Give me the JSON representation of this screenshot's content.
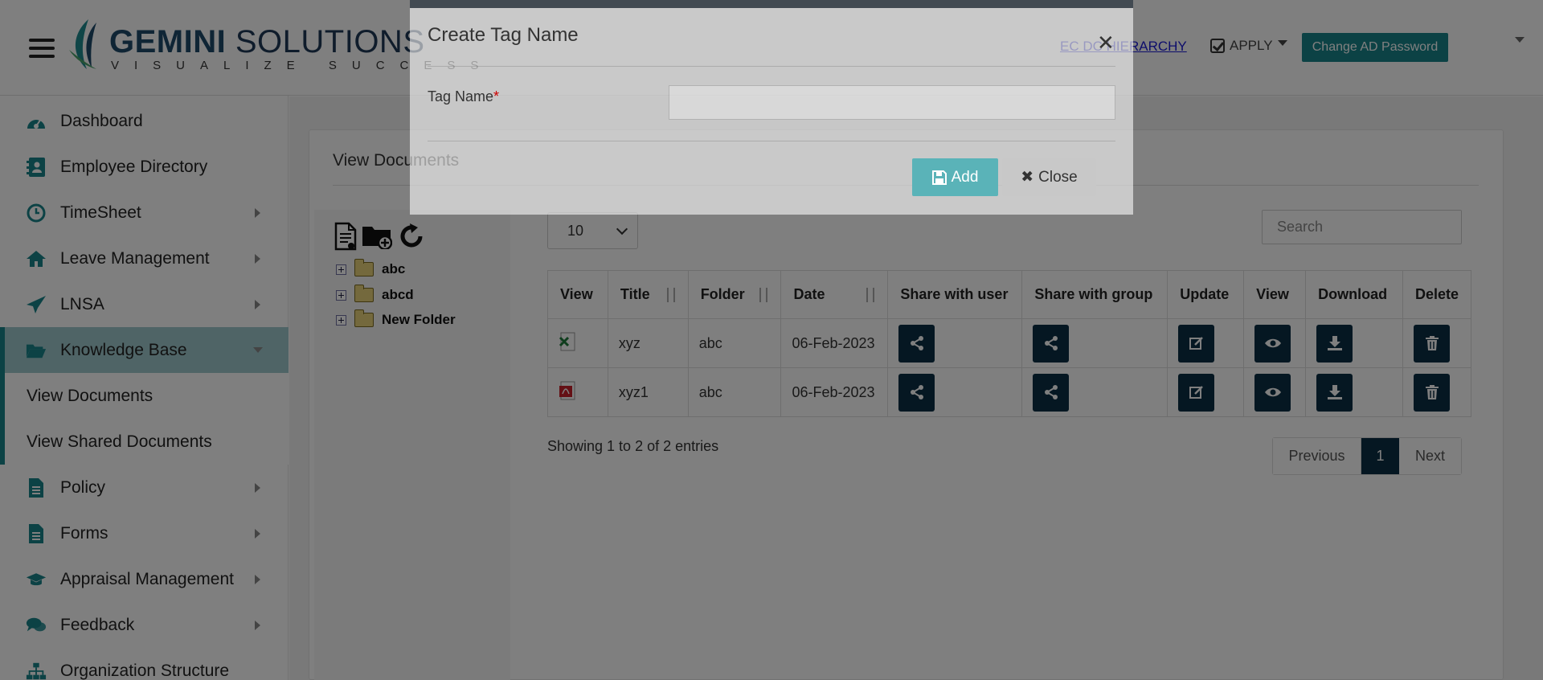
{
  "header": {
    "logo_main_bold": "GEMINI",
    "logo_main_rest": " SOLUTIONS",
    "logo_tagline": "VISUALIZE SUCCESS",
    "hierarchy_link": "EC DC HIERARCHY",
    "apply_label": "APPLY",
    "change_password_label": "Change AD Password"
  },
  "sidebar": {
    "items": [
      {
        "label": "Dashboard",
        "icon": "dashboard-icon"
      },
      {
        "label": "Employee Directory",
        "icon": "address-book-icon"
      },
      {
        "label": "TimeSheet",
        "icon": "clock-icon"
      },
      {
        "label": "Leave Management",
        "icon": "home-icon"
      },
      {
        "label": "LNSA",
        "icon": "paper-plane-icon"
      },
      {
        "label": "Knowledge Base",
        "icon": "folder-open-icon"
      },
      {
        "label": "Policy",
        "icon": "document-icon"
      },
      {
        "label": "Forms",
        "icon": "document-icon"
      },
      {
        "label": "Appraisal Management",
        "icon": "graduation-cap-icon"
      },
      {
        "label": "Feedback",
        "icon": "comments-icon"
      },
      {
        "label": "Organization Structure",
        "icon": "sitemap-icon"
      }
    ],
    "sub_items": [
      "View Documents",
      "View Shared Documents"
    ]
  },
  "main": {
    "title": "View Documents",
    "tree": {
      "folders": [
        "abc",
        "abcd",
        "New Folder"
      ]
    },
    "page_length": "10",
    "search_placeholder": "Search",
    "table": {
      "columns": [
        "View",
        "Title",
        "Folder",
        "Date",
        "Share with user",
        "Share with group",
        "Update",
        "View",
        "Download",
        "Delete"
      ],
      "rows": [
        {
          "file_type": "excel",
          "title": "xyz",
          "folder": "abc",
          "date": "06-Feb-2023"
        },
        {
          "file_type": "pdf",
          "title": "xyz1",
          "folder": "abc",
          "date": "06-Feb-2023"
        }
      ]
    },
    "info": "Showing 1 to 2 of 2 entries",
    "pagination": {
      "previous": "Previous",
      "current": "1",
      "next": "Next"
    }
  },
  "modal": {
    "title": "Create Tag Name",
    "field_label": "Tag Name",
    "required_mark": "*",
    "field_value": "",
    "add_label": "Add",
    "close_label": "Close"
  },
  "colors": {
    "accent": "#19858b",
    "dark_button": "#0b2f44",
    "active_nav": "#9ec9cc",
    "modal_border": "#424a52"
  }
}
